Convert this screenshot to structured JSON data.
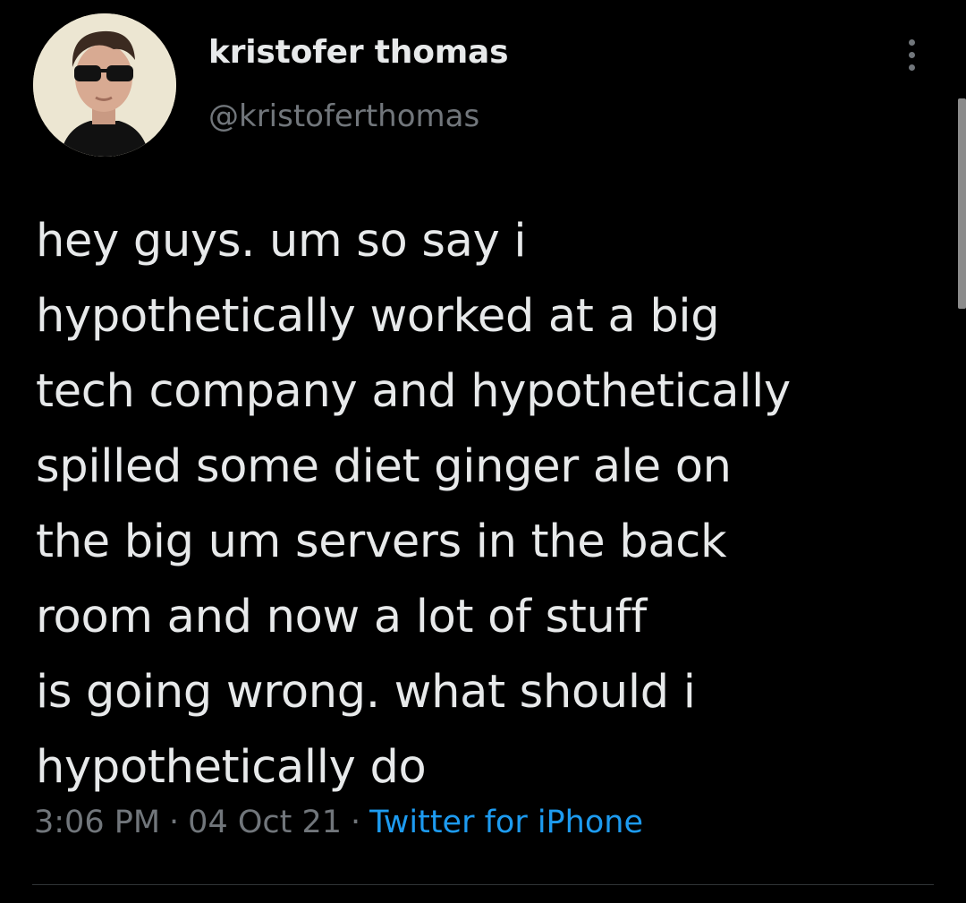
{
  "tweet": {
    "author": {
      "display_name": "kristofer thomas",
      "handle": "@kristoferthomas"
    },
    "avatar_icon": "profile-photo",
    "more_icon": "vertical-ellipsis-icon",
    "text": "hey guys. um so say i\nhypothetically worked at a big\ntech company and hypothetically\nspilled some diet ginger ale on\nthe big um servers in the back\nroom and now a lot of stuff\nis going wrong. what should i\nhypothetically do",
    "time": "3:06 PM",
    "date": "04 Oct 21",
    "separator": "·",
    "source": "Twitter for iPhone"
  },
  "colors": {
    "background": "#000000",
    "text_primary": "#e7e9ea",
    "text_secondary": "#71767b",
    "accent": "#1d9bf0"
  }
}
